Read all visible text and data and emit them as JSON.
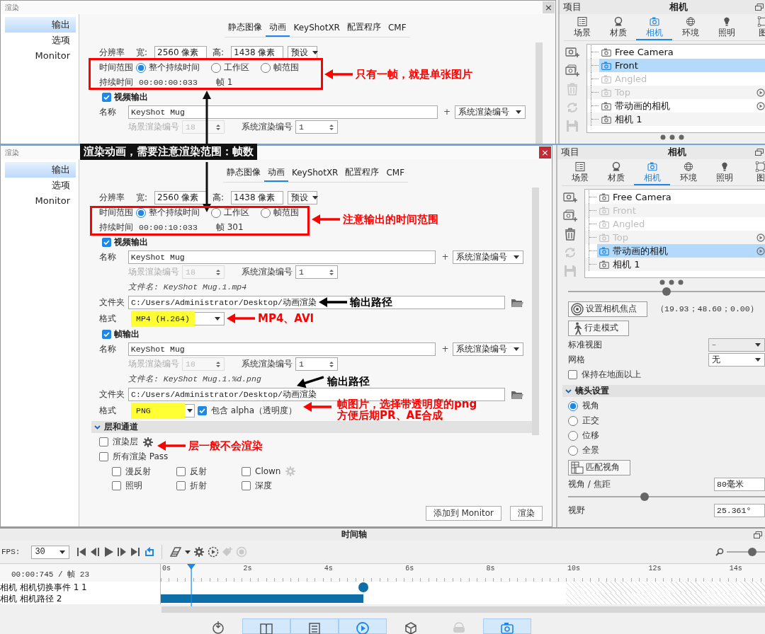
{
  "screens": [
    {
      "render_dialog": {
        "title": "渲染",
        "close": "×",
        "sidebar": [
          {
            "label": "输出",
            "selected": true
          },
          {
            "label": "选项",
            "selected": false
          },
          {
            "label": "Monitor",
            "selected": false
          }
        ],
        "tabs": [
          {
            "label": "静态图像",
            "selected": false
          },
          {
            "label": "动画",
            "selected": true
          },
          {
            "label": "KeyShotXR",
            "selected": false
          },
          {
            "label": "配置程序",
            "selected": false
          },
          {
            "label": "CMF",
            "selected": false
          }
        ],
        "resolution": {
          "label": "分辨率",
          "width_label": "宽:",
          "width": "2560 像素",
          "height_label": "高:",
          "height": "1438 像素",
          "preset": "预设"
        },
        "time_range": {
          "label": "时间范围",
          "options": [
            {
              "label": "整个持续时间",
              "selected": true
            },
            {
              "label": "工作区",
              "selected": false
            },
            {
              "label": "帧范围",
              "selected": false
            }
          ]
        },
        "duration": {
          "label": "持续时间",
          "value": "00:00:00:033",
          "frame": "帧 1"
        },
        "outputs": [
          {
            "title": "视频输出",
            "checked": true,
            "name_label": "名称",
            "name": "KeyShot Mug",
            "plus": "+",
            "suffix": "系统渲染编号",
            "scene_label": "场景渲染编号",
            "scene_value": "18",
            "system_label": "系统渲染编号",
            "system_value": "1"
          }
        ]
      },
      "camera_panel": {
        "header_left": "项目",
        "title": "相机",
        "tabs": [
          {
            "kind": "scene",
            "label": "场景",
            "selected": false
          },
          {
            "kind": "material",
            "label": "材质",
            "selected": false
          },
          {
            "kind": "camera",
            "label": "相机",
            "selected": true
          },
          {
            "kind": "environment",
            "label": "环境",
            "selected": false
          },
          {
            "kind": "lighting",
            "label": "照明",
            "selected": false
          },
          {
            "kind": "image",
            "label": "图",
            "selected": false
          }
        ],
        "tools": [
          {
            "kind": "add",
            "disabled": false
          },
          {
            "kind": "duplicate",
            "disabled": false
          },
          {
            "kind": "delete",
            "disabled": true
          },
          {
            "kind": "refresh",
            "disabled": true
          },
          {
            "kind": "save",
            "disabled": true
          }
        ],
        "cameras": [
          {
            "label": "Free Camera",
            "selected": false,
            "disabled": false,
            "animated": false
          },
          {
            "label": "Front",
            "selected": true,
            "disabled": false,
            "animated": false
          },
          {
            "label": "Angled",
            "selected": false,
            "disabled": true,
            "animated": false
          },
          {
            "label": "Top",
            "selected": false,
            "disabled": true,
            "animated": true
          },
          {
            "label": "带动画的相机",
            "selected": false,
            "disabled": false,
            "animated": true
          },
          {
            "label": "相机 1",
            "selected": false,
            "disabled": false,
            "animated": false
          }
        ]
      }
    },
    {
      "render_dialog": {
        "title": "渲染",
        "close": "×",
        "sidebar": [
          {
            "label": "输出",
            "selected": true
          },
          {
            "label": "选项",
            "selected": false
          },
          {
            "label": "Monitor",
            "selected": false
          }
        ],
        "tabs": [
          {
            "label": "静态图像",
            "selected": false
          },
          {
            "label": "动画",
            "selected": true
          },
          {
            "label": "KeyShotXR",
            "selected": false
          },
          {
            "label": "配置程序",
            "selected": false
          },
          {
            "label": "CMF",
            "selected": false
          }
        ],
        "resolution": {
          "label": "分辨率",
          "width_label": "宽:",
          "width": "2560 像素",
          "height_label": "高:",
          "height": "1438 像素",
          "preset": "预设"
        },
        "time_range": {
          "label": "时间范围",
          "options": [
            {
              "label": "整个持续时间",
              "selected": true
            },
            {
              "label": "工作区",
              "selected": false
            },
            {
              "label": "帧范围",
              "selected": false
            }
          ]
        },
        "duration": {
          "label": "持续时间",
          "value": "00:00:10:033",
          "frame": "帧 301"
        },
        "outputs": [
          {
            "title": "视频输出",
            "checked": true,
            "name_label": "名称",
            "name": "KeyShot Mug",
            "plus": "+",
            "suffix": "系统渲染编号",
            "scene_label": "场景渲染编号",
            "scene_value": "18",
            "system_label": "系统渲染编号",
            "system_value": "1",
            "filename": "文件名: KeyShot Mug.1.mp4",
            "folder_label": "文件夹",
            "folder": "C:/Users/Administrator/Desktop/动画渲染",
            "format_label": "格式",
            "format": "MP4 (H.264)",
            "highlight": true
          },
          {
            "title": "帧输出",
            "checked": true,
            "name_label": "名称",
            "name": "KeyShot Mug",
            "plus": "+",
            "suffix": "系统渲染编号",
            "scene_label": "场景渲染编号",
            "scene_value": "18",
            "system_label": "系统渲染编号",
            "system_value": "1",
            "filename": "文件名: KeyShot Mug.1.%d.png",
            "folder_label": "文件夹",
            "folder": "C:/Users/Administrator/Desktop/动画渲染",
            "format_label": "格式",
            "format": "PNG",
            "highlight": true,
            "alpha": {
              "label": "包含 alpha（透明度）",
              "checked": true
            }
          }
        ],
        "layers": {
          "title": "层和通道",
          "expanded": true,
          "render_layers": {
            "label": "渲染层",
            "checked": false
          },
          "all_passes": {
            "label": "所有渲染 Pass",
            "checked": false
          },
          "passes": [
            {
              "label": "漫反射",
              "checked": false,
              "settings": false
            },
            {
              "label": "反射",
              "checked": false,
              "settings": false
            },
            {
              "label": "Clown",
              "checked": false,
              "settings": true
            },
            {
              "label": "照明",
              "checked": false,
              "settings": false
            },
            {
              "label": "折射",
              "checked": false,
              "settings": false
            },
            {
              "label": "深度",
              "checked": false,
              "settings": false
            }
          ]
        },
        "buttons": [
          "添加到 Monitor",
          "渲染"
        ]
      },
      "camera_panel": {
        "header_left": "项目",
        "title": "相机",
        "tabs": [
          {
            "kind": "scene",
            "label": "场景",
            "selected": false
          },
          {
            "kind": "material",
            "label": "材质",
            "selected": false
          },
          {
            "kind": "camera",
            "label": "相机",
            "selected": true
          },
          {
            "kind": "environment",
            "label": "环境",
            "selected": false
          },
          {
            "kind": "lighting",
            "label": "照明",
            "selected": false
          },
          {
            "kind": "image",
            "label": "图",
            "selected": false
          }
        ],
        "tools": [
          {
            "kind": "add",
            "disabled": false
          },
          {
            "kind": "duplicate",
            "disabled": false
          },
          {
            "kind": "delete",
            "disabled": false
          },
          {
            "kind": "refresh",
            "disabled": true
          },
          {
            "kind": "save",
            "disabled": true
          }
        ],
        "cameras": [
          {
            "label": "Free Camera",
            "selected": false,
            "disabled": false,
            "animated": false
          },
          {
            "label": "Front",
            "selected": false,
            "disabled": true,
            "animated": false
          },
          {
            "label": "Angled",
            "selected": false,
            "disabled": true,
            "animated": false
          },
          {
            "label": "Top",
            "selected": false,
            "disabled": true,
            "animated": true
          },
          {
            "label": "带动画的相机",
            "selected": true,
            "disabled": false,
            "animated": true
          },
          {
            "label": "相机 1",
            "selected": false,
            "disabled": false,
            "animated": false
          }
        ],
        "properties": {
          "top_slider": {
            "level": 0.5
          },
          "focus_button": "设置相机焦点",
          "focus_value": "（19.93；48.60；0.00）",
          "walk_button": "行走模式",
          "standard_view": {
            "label": "标准视图",
            "value": "–",
            "disabled": true
          },
          "grid": {
            "label": "网格",
            "value": "无",
            "disabled": false
          },
          "stay_above_ground": {
            "label": "保持在地面以上",
            "checked": false
          },
          "lens": {
            "title": "镜头设置",
            "expanded": true,
            "modes": [
              {
                "label": "视角",
                "selected": true
              },
              {
                "label": "正交",
                "selected": false
              },
              {
                "label": "位移",
                "selected": false
              },
              {
                "label": "全景",
                "selected": false
              }
            ]
          },
          "match_button": "匹配视角",
          "focal": {
            "label": "视角 / 焦距",
            "value": "80毫米"
          },
          "focal_slider": {
            "level": 0.39
          },
          "fov": {
            "label": "视野",
            "value": "25.361°"
          }
        }
      }
    }
  ],
  "timeline": {
    "title": "时间轴",
    "fps_label": "FPS:",
    "fps": "30",
    "zoom_slider": {
      "level": 0.66
    },
    "time": "00:00:745 / 帧 23",
    "ruler": [
      "0s",
      "2s",
      "4s",
      "6s",
      "8s",
      "10s",
      "12s",
      "14s"
    ],
    "playhead": {
      "level": 0.052
    },
    "tracks": [
      {
        "label": "相机 相机切换事件 1 1"
      },
      {
        "label": "相机 相机路径 2"
      }
    ],
    "dock": [
      {
        "kind": "import",
        "selected": false
      },
      {
        "kind": "library",
        "selected": true
      },
      {
        "kind": "project",
        "selected": true
      },
      {
        "kind": "animation",
        "selected": true
      },
      {
        "kind": "model",
        "selected": false
      },
      {
        "kind": "vr",
        "selected": false
      },
      {
        "kind": "render",
        "selected": true
      }
    ]
  },
  "annotations": [
    {
      "kind": "box",
      "color": "#ff0000"
    },
    {
      "kind": "callout",
      "text": "只有一帧，就是单张图片",
      "color": "#ff0000"
    },
    {
      "kind": "banner",
      "text": "渲染动画，需要注意渲染范围：帧数"
    },
    {
      "kind": "box",
      "color": "#ff0000"
    },
    {
      "kind": "callout",
      "text": "注意输出的时间范围",
      "color": "#ff0000"
    },
    {
      "kind": "callout",
      "text": "输出路径",
      "color": "#000000"
    },
    {
      "kind": "callout",
      "text": "MP4、AVI",
      "color": "#ff0000"
    },
    {
      "kind": "callout",
      "text": "输出路径",
      "color": "#000000"
    },
    {
      "kind": "callout",
      "text": "帧图片，选择带透明度的png\n方便后期PR、AE合成",
      "color": "#ff0000"
    },
    {
      "kind": "callout",
      "text": "层一般不会渲染",
      "color": "#ff0000"
    }
  ]
}
